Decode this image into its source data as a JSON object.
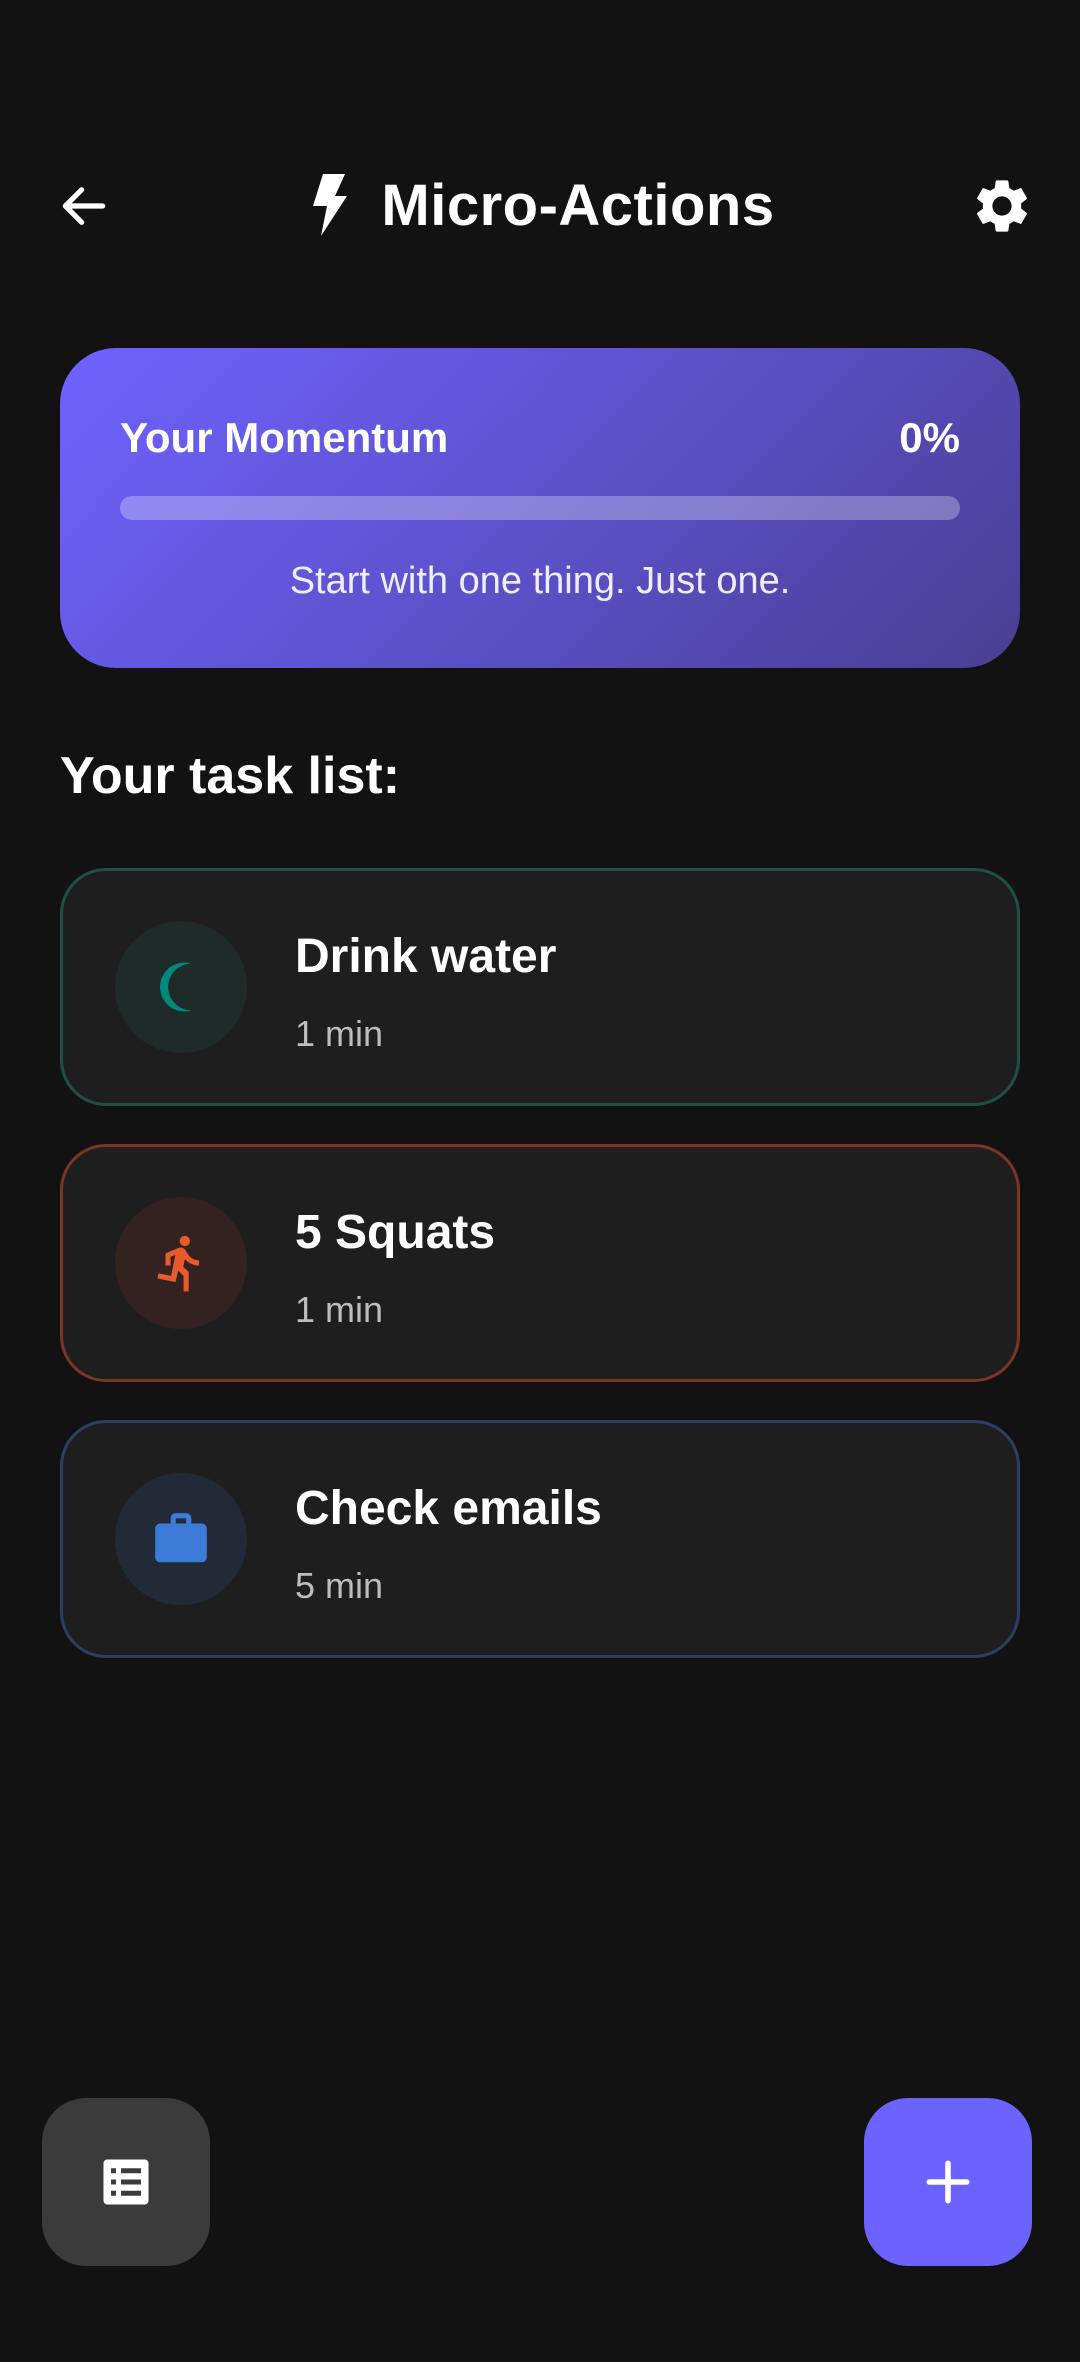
{
  "header": {
    "title": "Micro-Actions",
    "back_icon": "arrow-left-icon",
    "title_icon": "bolt-icon",
    "settings_icon": "gear-icon"
  },
  "momentum": {
    "label": "Your Momentum",
    "percent_text": "0%",
    "progress": 0,
    "caption": "Start with one thing. Just one."
  },
  "task_section": {
    "title": "Your task list:"
  },
  "tasks": [
    {
      "title": "Drink water",
      "duration": "1 min",
      "icon": "moon-icon",
      "accent": "#00897b"
    },
    {
      "title": "5 Squats",
      "duration": "1 min",
      "icon": "running-person-icon",
      "accent": "#e65a2e"
    },
    {
      "title": "Check emails",
      "duration": "5 min",
      "icon": "briefcase-icon",
      "accent": "#3d7bd8"
    }
  ],
  "footer": {
    "list_icon": "list-icon",
    "add_icon": "plus-icon"
  },
  "colors": {
    "background": "#121212",
    "primary": "#6c63ff",
    "card": "#1e1e1e"
  }
}
